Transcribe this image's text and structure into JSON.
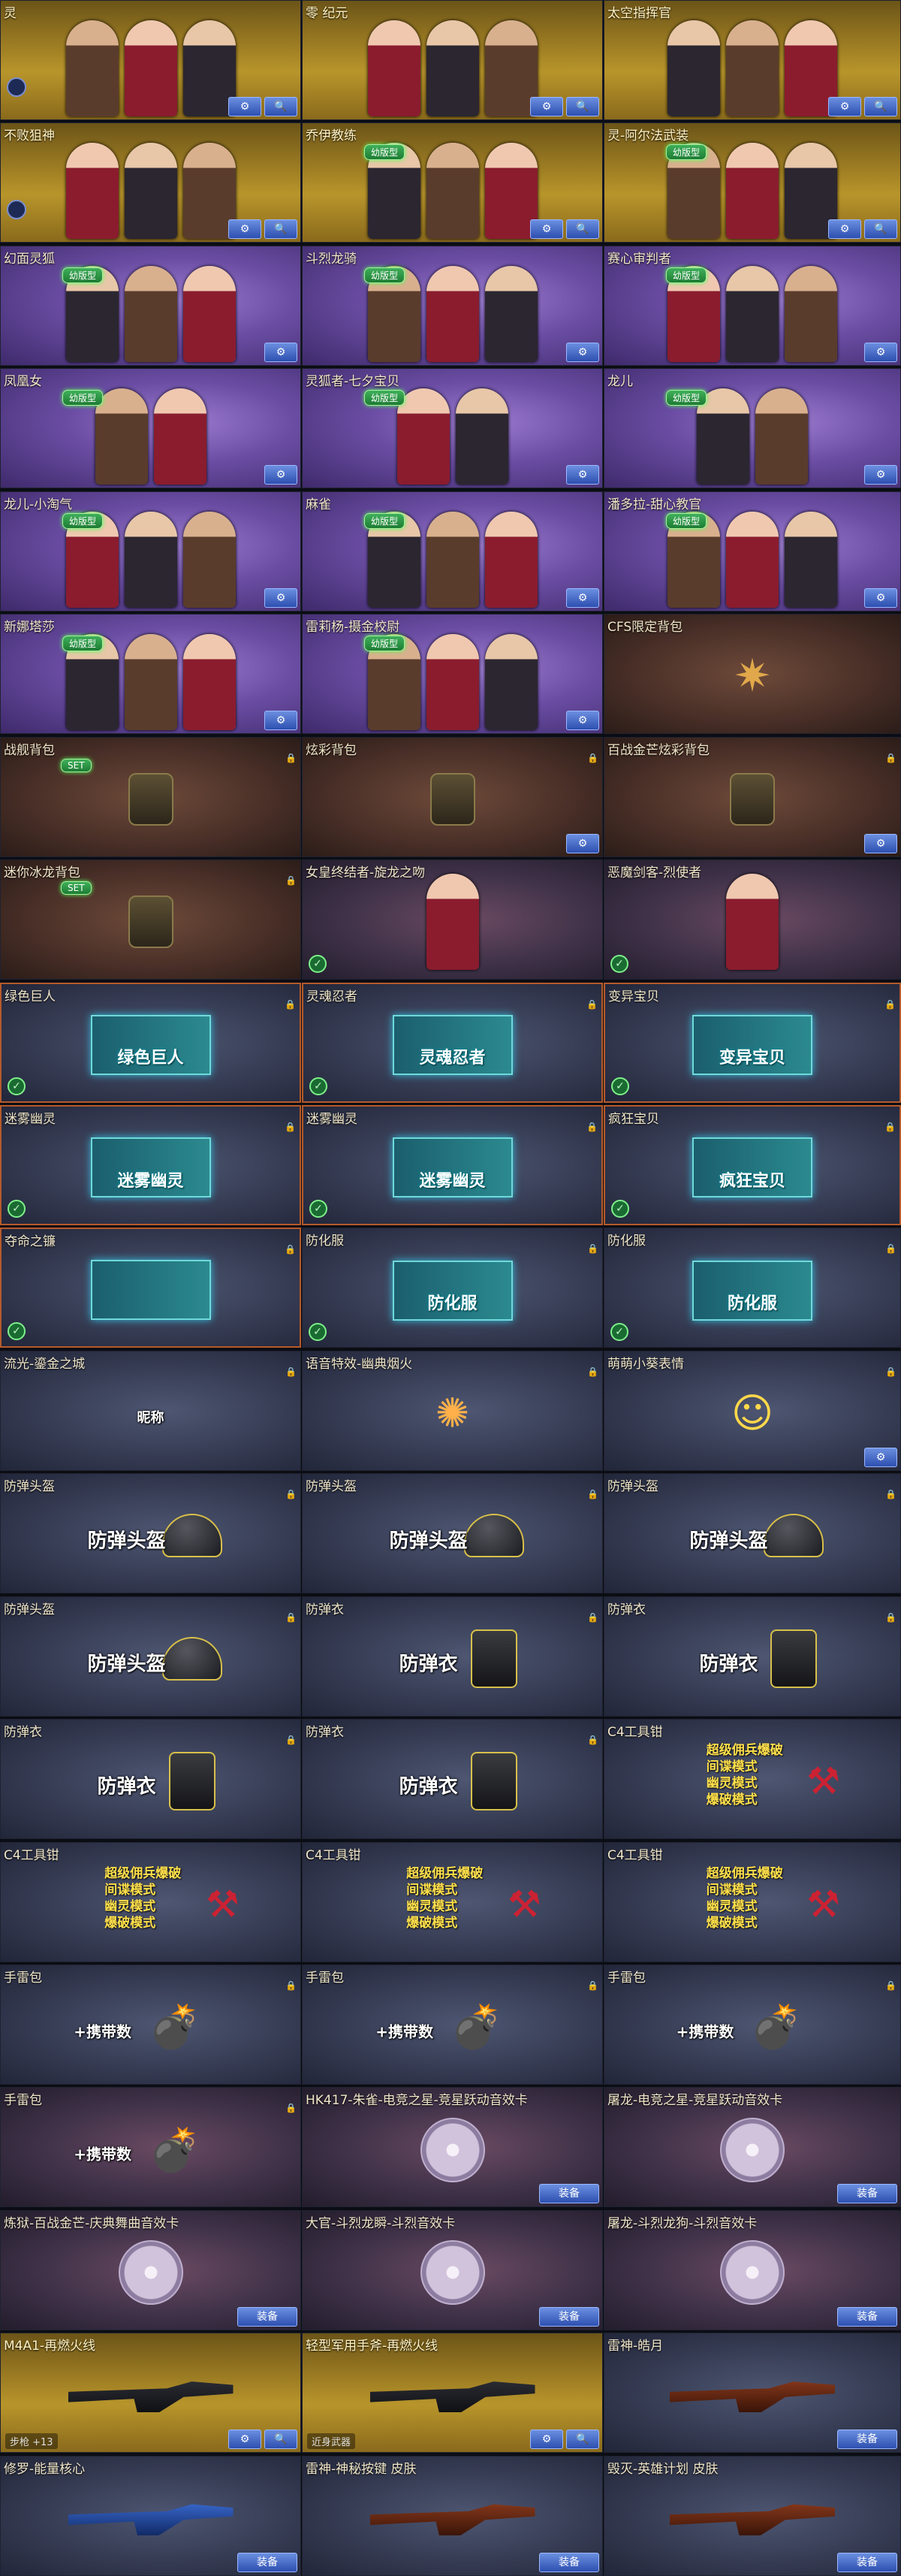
{
  "buttons": {
    "search": "🔍",
    "settings": "⚙",
    "equip": "装备",
    "set": "SET"
  },
  "badges": {
    "limited": "幼版型",
    "set": "SET"
  },
  "row1": [
    "灵",
    "零 纪元",
    "太空指挥官"
  ],
  "row2": [
    "不败狙神",
    "乔伊教练",
    "灵-阿尔法武装"
  ],
  "row3": [
    "幻面灵狐",
    "斗烈龙骑",
    "赛心审判者"
  ],
  "row4": [
    "凤凰女",
    "灵狐者-七夕宝贝",
    "龙儿"
  ],
  "row5": [
    "龙儿-小淘气",
    "麻雀",
    "潘多拉-甜心教官"
  ],
  "row6": [
    "新娜塔莎",
    "雷莉杨-摄金校尉",
    "CFS限定背包"
  ],
  "row7": [
    "战舰背包",
    "炫彩背包",
    "百战金芒炫彩背包"
  ],
  "row8": [
    "迷你冰龙背包",
    "女皇终结者-旋龙之吻",
    "恶魔剑客-烈使者"
  ],
  "row9": [
    "绿色巨人",
    "灵魂忍者",
    "变异宝贝"
  ],
  "row9_labels": [
    "绿色巨人",
    "灵魂忍者",
    "变异宝贝"
  ],
  "row10": [
    "迷雾幽灵",
    "迷雾幽灵",
    "疯狂宝贝"
  ],
  "row10_labels": [
    "迷雾幽灵",
    "迷雾幽灵",
    "疯狂宝贝"
  ],
  "row11": [
    "夺命之镰",
    "防化服",
    "防化服"
  ],
  "row11_labels": [
    "",
    "防化服",
    "防化服"
  ],
  "row12": [
    "流光-鎏金之城",
    "语音特效-幽典烟火",
    "萌萌小葵表情"
  ],
  "row12_text": "昵称",
  "row13": [
    "防弹头盔",
    "防弹头盔",
    "防弹头盔"
  ],
  "row14": [
    "防弹头盔",
    "防弹衣",
    "防弹衣"
  ],
  "row15": [
    "防弹衣",
    "防弹衣",
    "C4工具钳"
  ],
  "row16": [
    "C4工具钳",
    "C4工具钳",
    "C4工具钳"
  ],
  "c4modes": [
    "超级佣兵爆破",
    "间谍模式",
    "幽灵模式",
    "爆破模式"
  ],
  "row17": [
    "手雷包",
    "手雷包",
    "手雷包"
  ],
  "grenade_label": "+携带数",
  "row18": [
    "手雷包",
    "HK417-朱雀-电竞之星-竞星跃动音效卡",
    "屠龙-电竞之星-竞星跃动音效卡"
  ],
  "row19": [
    "炼狱-百战金芒-庆典舞曲音效卡",
    "大官-斗烈龙瞬-斗烈音效卡",
    "屠龙-斗烈龙狗-斗烈音效卡"
  ],
  "row20": [
    "M4A1-再燃火线",
    "轻型军用手斧-再燃火线",
    "雷神-皓月"
  ],
  "row20_footer": [
    "步枪 +13",
    "近身武器",
    ""
  ],
  "row21": [
    "修罗-能量核心",
    "雷神-神秘按键 皮肤",
    "毁灭-英雄计划 皮肤"
  ],
  "item_captions": {
    "helmet": "防弹头盔",
    "vest": "防弹衣"
  }
}
